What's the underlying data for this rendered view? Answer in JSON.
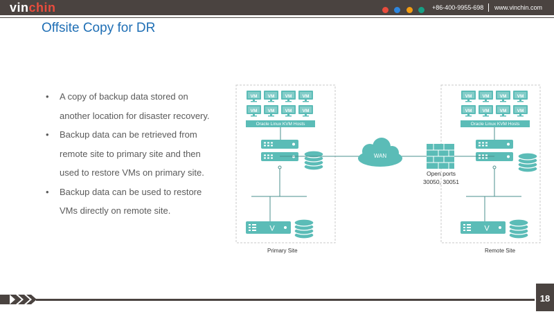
{
  "header": {
    "logo_part1": "vin",
    "logo_part2": "chin",
    "phone": "+86-400-9955-698",
    "website": "www.vinchin.com",
    "dot_colors": [
      "#e84c3d",
      "#2e86de",
      "#f39c12",
      "#16a085"
    ]
  },
  "slide": {
    "title": "Offsite Copy for DR",
    "bullets": [
      "A copy of backup data stored on another location for disaster recovery.",
      "Backup data can be retrieved from remote site to primary site and then used to restore VMs on primary site.",
      "Backup data can be used to restore VMs directly on remote site."
    ],
    "bullet_lines": [
      [
        "A copy of backup data stored on",
        "another location for disaster recovery."
      ],
      [
        "Backup data can be retrieved from",
        "remote site to primary site and then",
        "used to restore VMs on primary site."
      ],
      [
        "Backup data can be used to restore",
        "VMs directly on remote site."
      ]
    ],
    "page_number": "18"
  },
  "diagram": {
    "vm_label": "VM",
    "hosts_label": "Oracle  Linux  KVM Hosts",
    "wan_label": "WAN",
    "ports_label": "Open ports",
    "ports_value": "30050, 30051",
    "primary_site_label": "Primary Site",
    "remote_site_label": "Remote Site",
    "teal_color": "#5bbcb7"
  }
}
